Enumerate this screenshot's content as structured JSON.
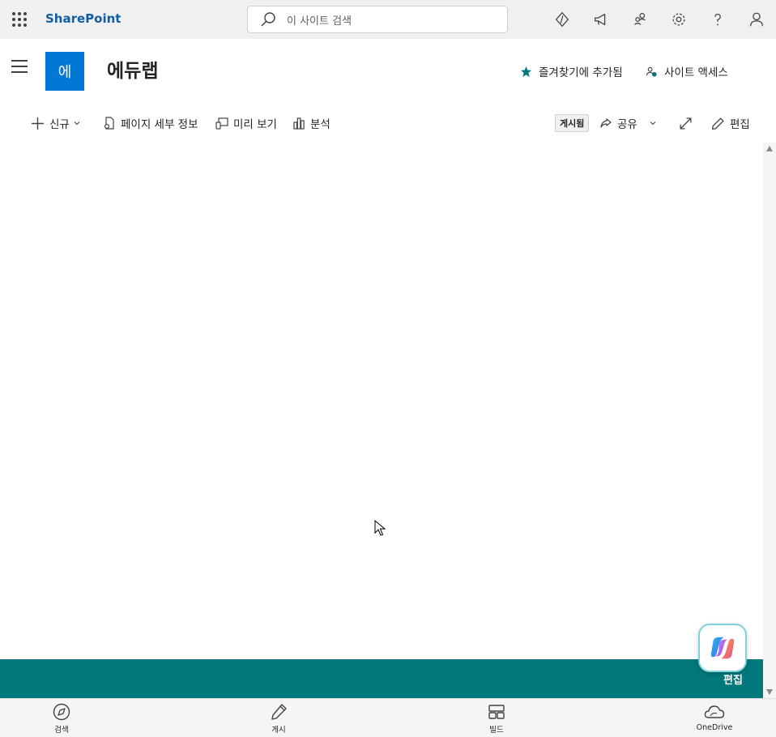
{
  "suite": {
    "brand": "SharePoint",
    "search_placeholder": "이 사이트 검색"
  },
  "site": {
    "logo_letter": "에",
    "title": "에듀랩",
    "favorite_label": "즐겨찾기에 추가됨",
    "site_access_label": "사이트 액세스"
  },
  "commands": {
    "new_label": "신규",
    "page_details_label": "페이지 세부 정보",
    "preview_label": "미리 보기",
    "analytics_label": "분석",
    "published_badge": "게시됨",
    "share_label": "공유",
    "edit_label": "편집"
  },
  "fab": {
    "edit_label": "편집"
  },
  "bottom_nav": {
    "items": [
      {
        "label": "검색",
        "icon": "compass-icon"
      },
      {
        "label": "게시",
        "icon": "pen-icon"
      },
      {
        "label": "빌드",
        "icon": "layout-icon"
      },
      {
        "label": "OneDrive",
        "icon": "cloud-icon"
      }
    ]
  },
  "colors": {
    "accent": "#0078d4",
    "theme_teal": "#03787c",
    "brand_text": "#115ea3"
  }
}
